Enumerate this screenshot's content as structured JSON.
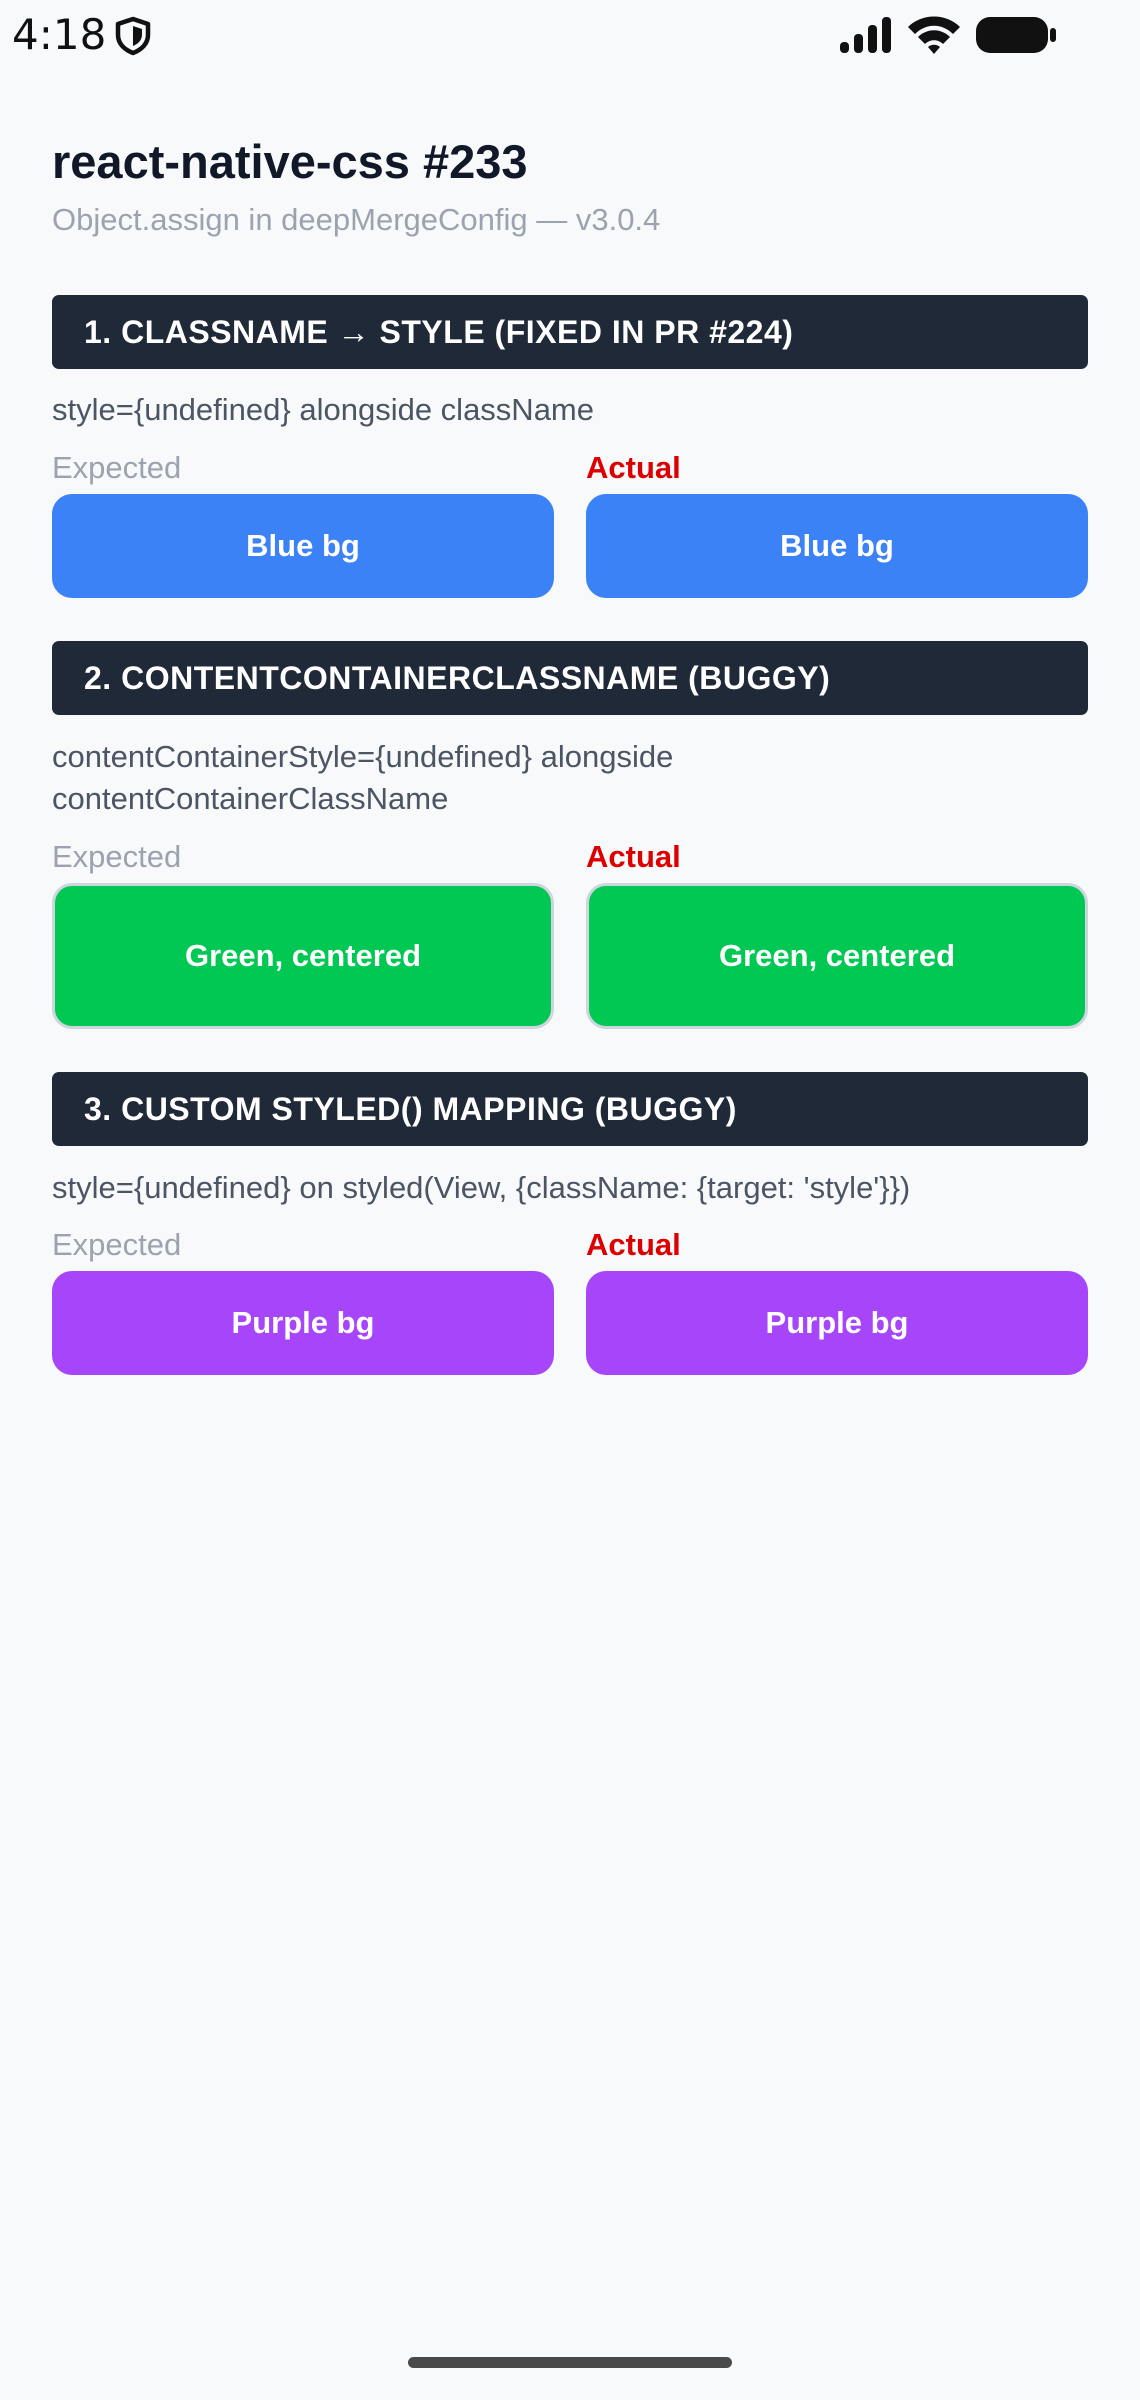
{
  "status_bar": {
    "time": "4:18",
    "icons": [
      "shield-icon",
      "signal-icon",
      "wifi-icon",
      "battery-icon"
    ]
  },
  "header": {
    "title": "react-native-css #233",
    "subtitle": "Object.assign in deepMergeConfig — v3.0.4"
  },
  "labels": {
    "expected": "Expected",
    "actual": "Actual"
  },
  "colors": {
    "section_header_bg": "#1f2937",
    "actual_label": "#dc0000",
    "blue": "#3b82f6",
    "green": "#00c853",
    "purple": "#a745fb"
  },
  "sections": [
    {
      "title": "1. CLASSNAME → STYLE (FIXED IN PR #224)",
      "description": "style={undefined} alongside className",
      "expected_text": "Blue bg",
      "actual_text": "Blue bg"
    },
    {
      "title": "2. CONTENTCONTAINERCLASSNAME (BUGGY)",
      "description": "contentContainerStyle={undefined} alongside contentContainerClassName",
      "expected_text": "Green, centered",
      "actual_text": "Green, centered"
    },
    {
      "title": "3. CUSTOM STYLED() MAPPING (BUGGY)",
      "description": "style={undefined} on styled(View, {className: {target: 'style'}})",
      "expected_text": "Purple bg",
      "actual_text": "Purple bg"
    }
  ]
}
